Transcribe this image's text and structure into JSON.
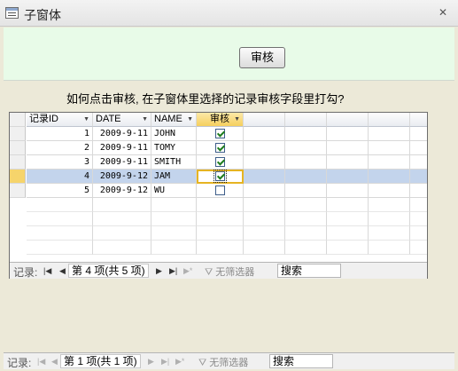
{
  "window": {
    "title": "子窗体",
    "close_glyph": "✕"
  },
  "header": {
    "audit_button_label": "审核"
  },
  "question": "如何点击审核, 在子窗体里选择的记录审核字段里打勾?",
  "subform": {
    "columns": [
      {
        "label": "记录ID"
      },
      {
        "label": "DATE"
      },
      {
        "label": "NAME"
      },
      {
        "label": "审核"
      }
    ],
    "rows": [
      {
        "id": "1",
        "date": "2009-9-11",
        "name": "JOHN",
        "checked": true
      },
      {
        "id": "2",
        "date": "2009-9-11",
        "name": "TOMY",
        "checked": true
      },
      {
        "id": "3",
        "date": "2009-9-11",
        "name": "SMITH",
        "checked": true
      },
      {
        "id": "4",
        "date": "2009-9-12",
        "name": "JAM",
        "checked": true
      },
      {
        "id": "5",
        "date": "2009-9-12",
        "name": "WU",
        "checked": false
      }
    ],
    "selected_row_index": 3,
    "nav": {
      "label": "记录:",
      "position": "第 4 项(共 5 项)",
      "filter": "无筛选器",
      "search": "搜索"
    }
  },
  "main_nav": {
    "label": "记录:",
    "position": "第 1 项(共 1 项)",
    "filter": "无筛选器",
    "search": "搜索"
  },
  "colors": {
    "header_bg": "#e8fbe8",
    "selected_row": "#c3d4ec",
    "current_selector": "#f6d46b"
  }
}
